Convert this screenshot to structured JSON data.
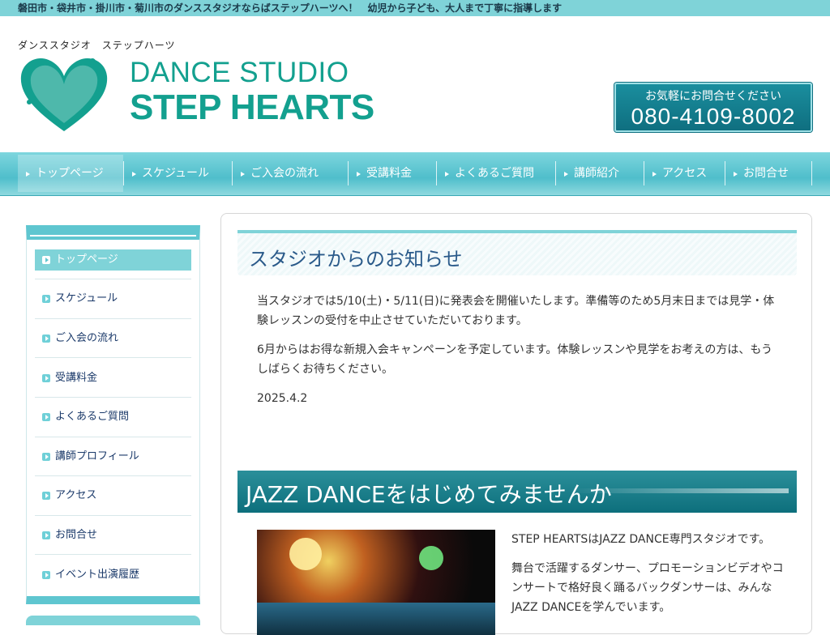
{
  "topbar": {
    "text": "磐田市・袋井市・掛川市・菊川市のダンススタジオならばステップハーツへ！　幼児から子ども、大人まで丁寧に指導します"
  },
  "header": {
    "kana": "ダンススタジオ　ステップハーツ",
    "logo_line1": "DANCE STUDIO",
    "logo_line2": "STEP HEARTS",
    "logo_mark_text": "dance studio Step Hearts",
    "tel_caption": "お気軽にお問合せください",
    "tel_number": "080-4109-8002"
  },
  "nav": {
    "items": [
      {
        "label": "トップページ",
        "active": true
      },
      {
        "label": "スケジュール"
      },
      {
        "label": "ご入会の流れ"
      },
      {
        "label": "受講料金"
      },
      {
        "label": "よくあるご質問"
      },
      {
        "label": "講師紹介"
      },
      {
        "label": "アクセス"
      },
      {
        "label": "お問合せ"
      }
    ]
  },
  "sidebar": {
    "items": [
      {
        "label": "トップページ",
        "active": true
      },
      {
        "label": "スケジュール"
      },
      {
        "label": "ご入会の流れ"
      },
      {
        "label": "受講料金"
      },
      {
        "label": "よくあるご質問"
      },
      {
        "label": "講師プロフィール"
      },
      {
        "label": "アクセス"
      },
      {
        "label": "お問合せ"
      },
      {
        "label": "イベント出演履歴"
      }
    ]
  },
  "main": {
    "notice_title": "スタジオからのお知らせ",
    "notice_p1": "当スタジオでは5/10(土)・5/11(日)に発表会を開催いたします。準備等のため5月末日までは見学・体験レッスンの受付を中止させていただいております。",
    "notice_p2": "6月からはお得な新規入会キャンペーンを予定しています。体験レッスンや見学をお考えの方は、もうしばらくお待ちください。",
    "notice_date": "2025.4.2",
    "jazz_title": "JAZZ DANCEをはじめてみませんか",
    "intro_p1": "STEP HEARTSはJAZZ DANCE専門スタジオです。",
    "intro_p2": "舞台で活躍するダンサー、プロモーションビデオやコンサートで格好良く踊るバックダンサーは、みんなJAZZ DANCEを学んでいます。"
  }
}
